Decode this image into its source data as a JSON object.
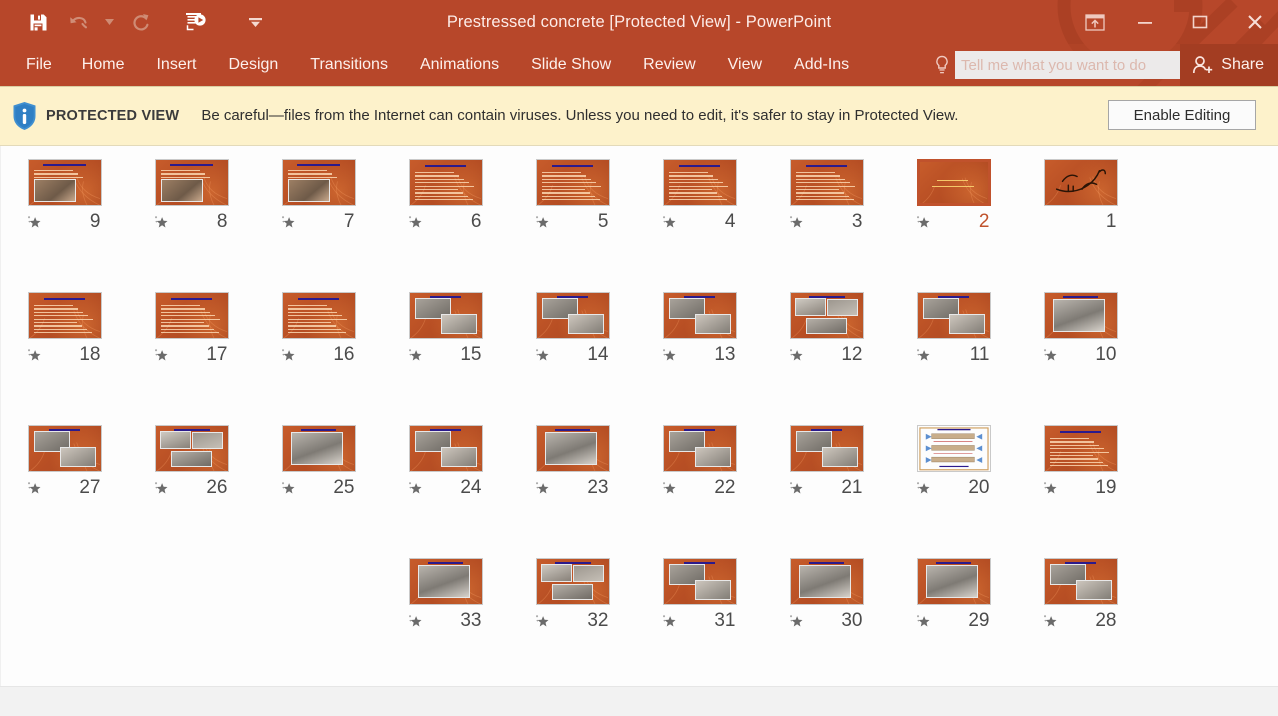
{
  "window": {
    "title": "Prestressed concrete [Protected View] - PowerPoint",
    "quick_access": [
      {
        "name": "save-icon",
        "label": "Save",
        "enabled": true
      },
      {
        "name": "undo-icon",
        "label": "Undo",
        "enabled": false
      },
      {
        "name": "undo-dropdown-icon",
        "label": "Undo options",
        "enabled": false
      },
      {
        "name": "redo-icon",
        "label": "Redo",
        "enabled": false
      },
      {
        "name": "start-slideshow-icon",
        "label": "Start From Beginning",
        "enabled": true
      },
      {
        "name": "customize-qat-icon",
        "label": "Customize Quick Access Toolbar",
        "enabled": true
      }
    ],
    "controls": [
      {
        "name": "ribbon-display-options-icon",
        "label": "Ribbon Display Options"
      },
      {
        "name": "minimize-icon",
        "label": "Minimize"
      },
      {
        "name": "restore-icon",
        "label": "Restore Down"
      },
      {
        "name": "close-icon",
        "label": "Close"
      }
    ]
  },
  "ribbon": {
    "tabs": [
      {
        "label": "File"
      },
      {
        "label": "Home"
      },
      {
        "label": "Insert"
      },
      {
        "label": "Design"
      },
      {
        "label": "Transitions"
      },
      {
        "label": "Animations"
      },
      {
        "label": "Slide Show"
      },
      {
        "label": "Review"
      },
      {
        "label": "View"
      },
      {
        "label": "Add-Ins"
      }
    ],
    "tell_me_placeholder": "Tell me what you want to do",
    "tell_me_value": "",
    "share_label": "Share"
  },
  "protected_view": {
    "label": "PROTECTED VIEW",
    "message": "Be careful—files from the Internet can contain viruses. Unless you need to edit, it's safer to stay in Protected View.",
    "enable_button": "Enable Editing"
  },
  "colors": {
    "title_bar": "#b7472a",
    "share_button": "#a33d22",
    "protected_bar": "#fdf2cb",
    "selection": "#c0522c",
    "slide_orange": "#c0572a"
  },
  "slides": {
    "selected": 2,
    "rows": [
      [
        {
          "number": "9",
          "star": true,
          "selected": false,
          "kind": "text-photo"
        },
        {
          "number": "8",
          "star": true,
          "selected": false,
          "kind": "text-photo"
        },
        {
          "number": "7",
          "star": true,
          "selected": false,
          "kind": "text-photo"
        },
        {
          "number": "6",
          "star": true,
          "selected": false,
          "kind": "text"
        },
        {
          "number": "5",
          "star": true,
          "selected": false,
          "kind": "text"
        },
        {
          "number": "4",
          "star": true,
          "selected": false,
          "kind": "text"
        },
        {
          "number": "3",
          "star": true,
          "selected": false,
          "kind": "text"
        },
        {
          "number": "2",
          "star": true,
          "selected": true,
          "kind": "title"
        },
        {
          "number": "1",
          "star": false,
          "selected": false,
          "kind": "calligraphy"
        }
      ],
      [
        {
          "number": "18",
          "star": true,
          "selected": false,
          "kind": "text"
        },
        {
          "number": "17",
          "star": true,
          "selected": false,
          "kind": "text"
        },
        {
          "number": "16",
          "star": true,
          "selected": false,
          "kind": "text"
        },
        {
          "number": "15",
          "star": true,
          "selected": false,
          "kind": "photo2"
        },
        {
          "number": "14",
          "star": true,
          "selected": false,
          "kind": "photo2"
        },
        {
          "number": "13",
          "star": true,
          "selected": false,
          "kind": "photo2"
        },
        {
          "number": "12",
          "star": true,
          "selected": false,
          "kind": "photo3"
        },
        {
          "number": "11",
          "star": true,
          "selected": false,
          "kind": "photo2"
        },
        {
          "number": "10",
          "star": true,
          "selected": false,
          "kind": "photo1"
        }
      ],
      [
        {
          "number": "27",
          "star": true,
          "selected": false,
          "kind": "photo2"
        },
        {
          "number": "26",
          "star": true,
          "selected": false,
          "kind": "photo3"
        },
        {
          "number": "25",
          "star": true,
          "selected": false,
          "kind": "photo1"
        },
        {
          "number": "24",
          "star": true,
          "selected": false,
          "kind": "photo2"
        },
        {
          "number": "23",
          "star": true,
          "selected": false,
          "kind": "photo1"
        },
        {
          "number": "22",
          "star": true,
          "selected": false,
          "kind": "photo2"
        },
        {
          "number": "21",
          "star": true,
          "selected": false,
          "kind": "photo2"
        },
        {
          "number": "20",
          "star": true,
          "selected": false,
          "kind": "diagram"
        },
        {
          "number": "19",
          "star": true,
          "selected": false,
          "kind": "text"
        }
      ],
      [
        {
          "number": "",
          "star": false,
          "selected": false,
          "kind": "blank",
          "empty": true
        },
        {
          "number": "",
          "star": false,
          "selected": false,
          "kind": "blank",
          "empty": true
        },
        {
          "number": "",
          "star": false,
          "selected": false,
          "kind": "blank",
          "empty": true
        },
        {
          "number": "33",
          "star": true,
          "selected": false,
          "kind": "photo1"
        },
        {
          "number": "32",
          "star": true,
          "selected": false,
          "kind": "photo3"
        },
        {
          "number": "31",
          "star": true,
          "selected": false,
          "kind": "photo2"
        },
        {
          "number": "30",
          "star": true,
          "selected": false,
          "kind": "photo1"
        },
        {
          "number": "29",
          "star": true,
          "selected": false,
          "kind": "photo1"
        },
        {
          "number": "28",
          "star": true,
          "selected": false,
          "kind": "photo2"
        }
      ]
    ]
  }
}
